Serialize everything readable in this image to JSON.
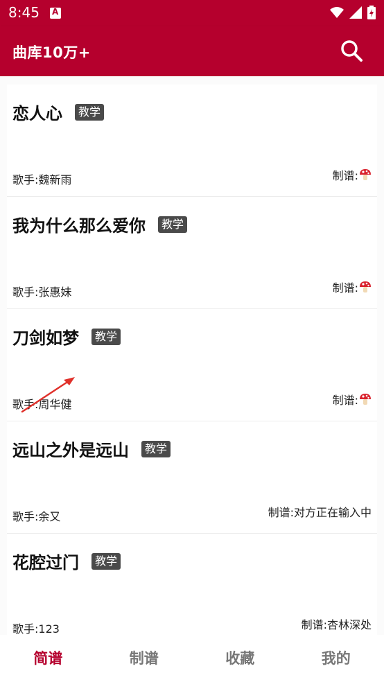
{
  "status_bar": {
    "time": "8:45"
  },
  "app_bar": {
    "title": "曲库10万+"
  },
  "badge_label": "教学",
  "songs": [
    {
      "title": "恋人心",
      "singer": "歌手:魏新雨",
      "arranger": "制谱:",
      "arranger_icon": "mushroom-icon"
    },
    {
      "title": "我为什么那么爱你",
      "singer": "歌手:张惠妹",
      "arranger": "制谱:",
      "arranger_icon": "mushroom-icon"
    },
    {
      "title": "刀剑如梦",
      "singer": "歌手:周华健",
      "arranger": "制谱:",
      "arranger_icon": "mushroom-icon"
    },
    {
      "title": "远山之外是远山",
      "singer": "歌手:余又",
      "arranger": "制谱:对方正在输入中"
    },
    {
      "title": "花腔过门",
      "singer": "歌手:123",
      "arranger": "制谱:杏林深处"
    }
  ],
  "bottom_nav": {
    "tabs": [
      {
        "label": "简谱",
        "active": true
      },
      {
        "label": "制谱",
        "active": false
      },
      {
        "label": "收藏",
        "active": false
      },
      {
        "label": "我的",
        "active": false
      }
    ]
  },
  "colors": {
    "brand": "#b5002d",
    "badge": "#4a4a4a"
  }
}
